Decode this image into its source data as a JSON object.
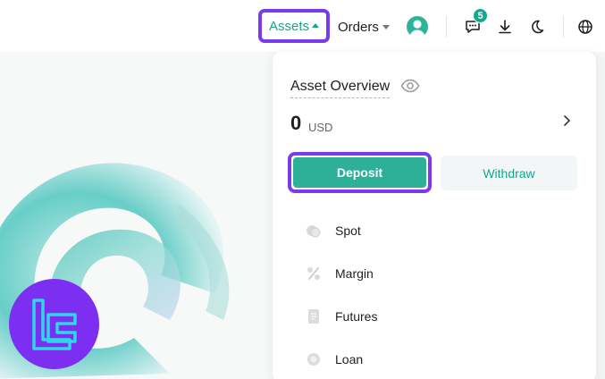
{
  "nav": {
    "assets_label": "Assets",
    "orders_label": "Orders",
    "notification_count": "5",
    "accent_color": "#17a58c",
    "highlight_color": "#7c3aed"
  },
  "assets_menu": {
    "overview_title": "Asset Overview",
    "balance_value": "0",
    "balance_unit": "USD",
    "deposit_label": "Deposit",
    "withdraw_label": "Withdraw",
    "items": [
      {
        "label": "Spot",
        "icon": "coins-icon"
      },
      {
        "label": "Margin",
        "icon": "percent-icon"
      },
      {
        "label": "Futures",
        "icon": "futures-icon"
      },
      {
        "label": "Loan",
        "icon": "loan-icon"
      }
    ]
  }
}
